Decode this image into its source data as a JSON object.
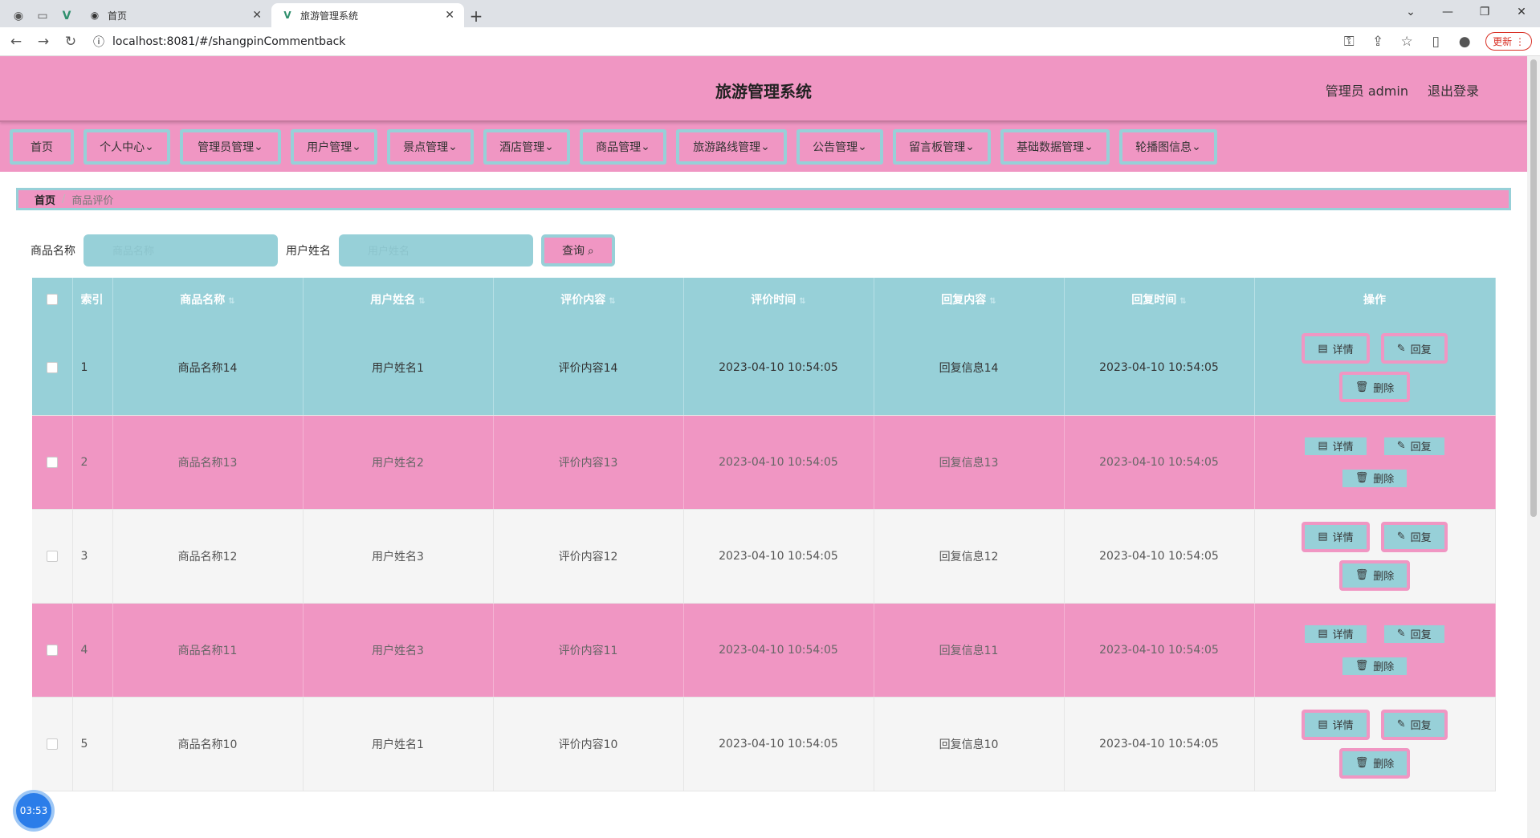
{
  "browser": {
    "tabs": [
      {
        "title": "首页",
        "active": false
      },
      {
        "title": "旅游管理系统",
        "active": true
      }
    ],
    "url": "localhost:8081/#/shangpinCommentback",
    "update_label": "更新"
  },
  "header": {
    "title": "旅游管理系统",
    "user": "管理员 admin",
    "logout": "退出登录"
  },
  "menu": {
    "items": [
      "首页",
      "个人中心",
      "管理员管理",
      "用户管理",
      "景点管理",
      "酒店管理",
      "商品管理",
      "旅游路线管理",
      "公告管理",
      "留言板管理",
      "基础数据管理",
      "轮播图信息"
    ]
  },
  "breadcrumb": {
    "home": "首页",
    "sep": "/",
    "current": "商品评价"
  },
  "search": {
    "goods_label": "商品名称",
    "goods_placeholder": "商品名称",
    "user_label": "用户姓名",
    "user_placeholder": "用户姓名",
    "query_label": "查询"
  },
  "actions": {
    "delete_label": "删除"
  },
  "table": {
    "headers": [
      "索引",
      "商品名称",
      "用户姓名",
      "评价内容",
      "评价时间",
      "回复内容",
      "回复时间",
      "操作"
    ],
    "rows": [
      {
        "index": "1",
        "goods": "商品名称14",
        "user": "用户姓名1",
        "content": "评价内容14",
        "time": "2023-04-10 10:54:05",
        "reply": "回复信息14",
        "reply_time": "2023-04-10 10:54:05"
      },
      {
        "index": "2",
        "goods": "商品名称13",
        "user": "用户姓名2",
        "content": "评价内容13",
        "time": "2023-04-10 10:54:05",
        "reply": "回复信息13",
        "reply_time": "2023-04-10 10:54:05"
      },
      {
        "index": "3",
        "goods": "商品名称12",
        "user": "用户姓名3",
        "content": "评价内容12",
        "time": "2023-04-10 10:54:05",
        "reply": "回复信息12",
        "reply_time": "2023-04-10 10:54:05"
      },
      {
        "index": "4",
        "goods": "商品名称11",
        "user": "用户姓名3",
        "content": "评价内容11",
        "time": "2023-04-10 10:54:05",
        "reply": "回复信息11",
        "reply_time": "2023-04-10 10:54:05"
      },
      {
        "index": "5",
        "goods": "商品名称10",
        "user": "用户姓名1",
        "content": "评价内容10",
        "time": "2023-04-10 10:54:05",
        "reply": "回复信息10",
        "reply_time": "2023-04-10 10:54:05"
      }
    ],
    "op_labels": {
      "detail": "详情",
      "reply": "回复",
      "delete": "删除"
    }
  },
  "timer": "03:53",
  "colors": {
    "pink": "#f096c3",
    "teal": "#97d0d8",
    "blue": "#2b7de9"
  }
}
